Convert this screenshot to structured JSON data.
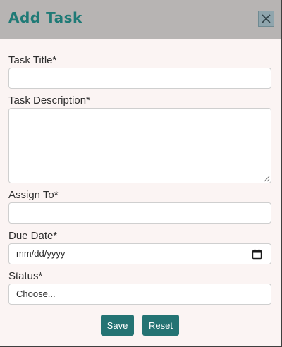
{
  "modal": {
    "title": "Add Task",
    "close_icon": "close-icon"
  },
  "form": {
    "task_title_label": "Task Title*",
    "task_title_value": "",
    "task_description_label": "Task Description*",
    "task_description_value": "",
    "assign_to_label": "Assign To*",
    "assign_to_value": "",
    "due_date_label": "Due Date*",
    "due_date_value": "mm/dd/yyyy",
    "status_label": "Status*",
    "status_selected": "Choose..."
  },
  "actions": {
    "save_label": "Save",
    "reset_label": "Reset"
  },
  "colors": {
    "title": "#1f7a76",
    "button": "#247373",
    "header": "#b7b4b3",
    "panel": "#fbf4f3"
  }
}
